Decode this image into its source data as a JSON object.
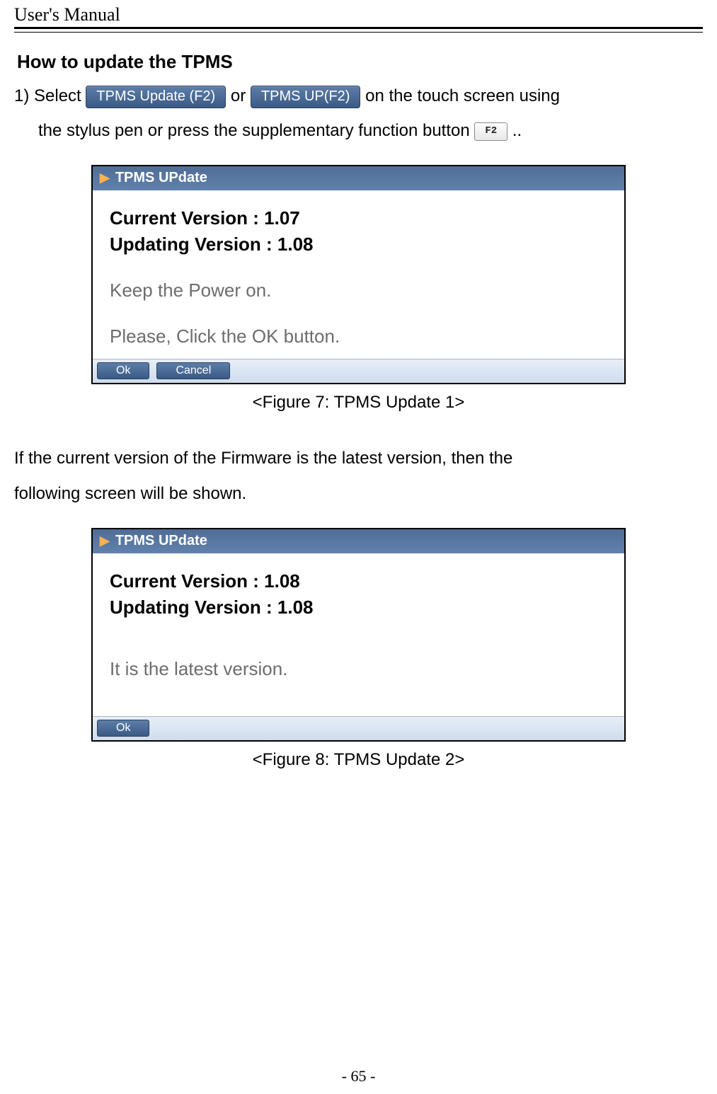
{
  "header": {
    "title": "User's Manual"
  },
  "section": {
    "heading": "How to update the TPMS"
  },
  "instr": {
    "prefix": "1) Select ",
    "btn1_label": "TPMS Update (F2)",
    "middle_or": " or ",
    "btn2_label": "TPMS UP(F2)",
    "tail1": " on the touch screen using",
    "line2_before": "the stylus pen or press the supplementary function button ",
    "key_label": "F2",
    "line2_after": ".."
  },
  "dialog1": {
    "title": "TPMS UPdate",
    "line_current": "Current Version : 1.07",
    "line_updating": "Updating Version : 1.08",
    "line_power": "Keep the Power on.",
    "line_click": "Please, Click the OK button.",
    "btn_ok": "Ok",
    "btn_cancel": "Cancel"
  },
  "caption1": "<Figure 7: TPMS Update 1>",
  "mid_para": {
    "line1": "If the current version of the Firmware is the latest version, then the",
    "line2": "following screen will be shown."
  },
  "dialog2": {
    "title": "TPMS UPdate",
    "line_current": "Current Version : 1.08",
    "line_updating": "Updating Version : 1.08",
    "line_latest": "It is the latest version.",
    "btn_ok": "Ok"
  },
  "caption2": "<Figure 8: TPMS Update 2>",
  "footer": {
    "page_number": "- 65 -"
  }
}
